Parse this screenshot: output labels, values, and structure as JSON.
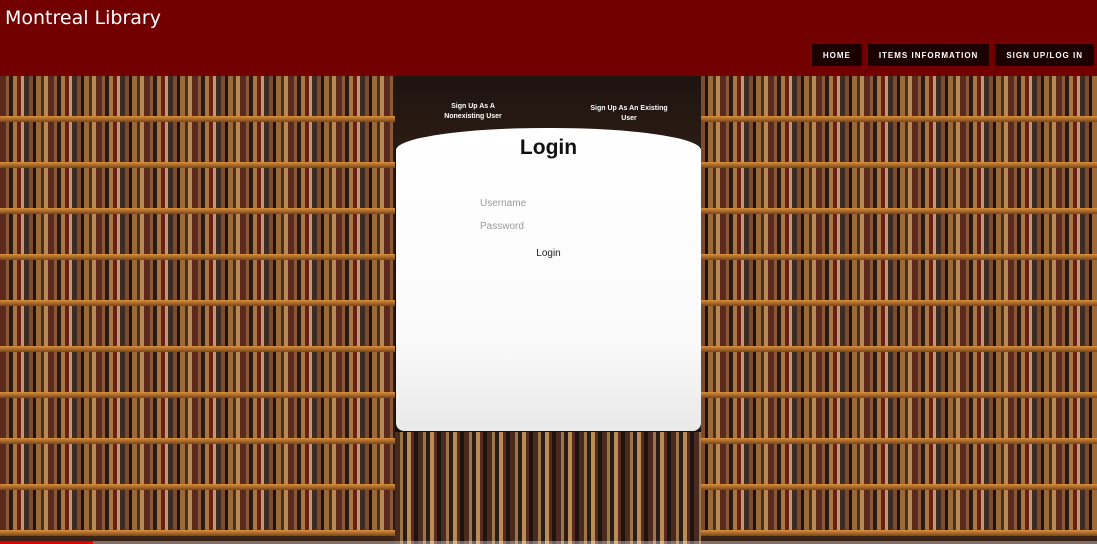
{
  "header": {
    "title": "Montreal Library",
    "bg_color": "#720000"
  },
  "nav": {
    "items": [
      {
        "label": "HOME"
      },
      {
        "label": "ITEMS INFORMATION"
      },
      {
        "label": "SIGN UP/LOG IN"
      }
    ]
  },
  "auth_tabs": {
    "new_user_label": "Sign Up As A Nonexisting User",
    "existing_user_label": "Sign Up As An Existing User"
  },
  "login_form": {
    "title": "Login",
    "username_placeholder": "Username",
    "password_placeholder": "Password",
    "submit_label": "Login"
  },
  "video_progress": {
    "fraction": 0.085,
    "color": "#e00000"
  }
}
